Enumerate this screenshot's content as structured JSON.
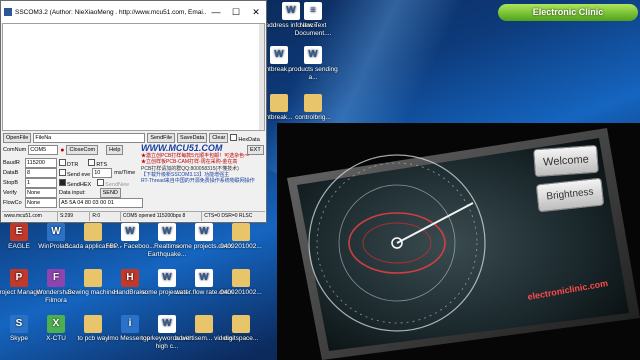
{
  "window": {
    "title": "SSCOM3.2 (Author: NieXiaoMeng . http://www.mcu51.com, Emai...",
    "controls": {
      "minimize": "—",
      "maximize": "☐",
      "close": "✕"
    }
  },
  "toolbar_row": {
    "open_file": "OpenFile",
    "file_name": "FileNa",
    "send_file": "SendFile",
    "save_data": "SaveData",
    "clear": "Clear",
    "hex_data": "HexData"
  },
  "port_row": {
    "comnum_label": "ComNum",
    "comnum_value": "COM5",
    "close_com": "CloseCom",
    "help": "Help",
    "ext": "EXT"
  },
  "settings": {
    "baud_label": "BaudR",
    "baud_value": "115200",
    "data_label": "DataB",
    "data_value": "8",
    "stop_label": "StopB",
    "stop_value": "1",
    "verify_label": "Verify",
    "verify_value": "None",
    "flow_label": "FlowCo",
    "flow_value": "None",
    "dtr": "DTR",
    "rts": "RTS",
    "send_eve": "Send eve",
    "interval": "10",
    "interval_unit": "ms/Time",
    "send_hex": "SendHEX",
    "send_new": "SendNew",
    "data_input_label": "Data input:",
    "send_button": "SEND",
    "data_input_value": "A5 5A 04 80 03 00 01"
  },
  "promo": {
    "line1": "★激立创PCB打样每款5元顺丰包邮！可选杂色～",
    "line2": "★立创样板PCB-CAM打样-周在采购-金在高",
    "line3": "PCB打样请加的群QQ:800058315(不懂技术)",
    "line4": "【下载升级新SSCOM3.13】功能增强主",
    "line5": "RT-Thread来自中国的开源免费操作系统物联网操作",
    "url": "WWW.MCU51.COM"
  },
  "statusbar": {
    "site": "www.mcu51.com",
    "s": "S:299",
    "r": "R:0",
    "port": "COM5 opened 115200bps 8",
    "lines": "CTS=0 DSR=0 RLSC"
  },
  "desktop_top": [
    {
      "label": "address info.docx",
      "icon": "word-doc-icon",
      "glyph": "W"
    },
    {
      "label": "New Text Document....",
      "icon": "text-file-icon",
      "glyph": "≡"
    },
    {
      "label": "ntbreak...",
      "icon": "word-doc-icon",
      "glyph": "W"
    },
    {
      "label": "products sending a...",
      "icon": "word-doc-icon",
      "glyph": "W"
    },
    {
      "label": "ntbreak...",
      "icon": "folder-icon",
      "glyph": ""
    },
    {
      "label": "controlbrig...",
      "icon": "file-icon",
      "glyph": ""
    }
  ],
  "desktop_left": [
    {
      "label": "EAGLE",
      "icon": "eagle-icon",
      "glyph": "E",
      "cls": "app"
    },
    {
      "label": "WinProlad...",
      "icon": "app-icon",
      "glyph": "W",
      "cls": "blue"
    },
    {
      "label": "Scada application...",
      "icon": "folder-icon",
      "glyph": "",
      "cls": "folder"
    },
    {
      "label": "FBP - Faceboo...",
      "icon": "word-doc-icon",
      "glyph": "W",
      "cls": "doc"
    },
    {
      "label": "Realtime Earthquake...",
      "icon": "word-doc-icon",
      "glyph": "W",
      "cls": "doc"
    },
    {
      "label": "some projects.docx",
      "icon": "word-doc-icon",
      "glyph": "W",
      "cls": "doc"
    },
    {
      "label": "0409201002...",
      "icon": "folder-icon",
      "glyph": "",
      "cls": "folder"
    },
    {
      "label": "Project Manager",
      "icon": "project-icon",
      "glyph": "P",
      "cls": "app"
    },
    {
      "label": "Wondershare Filmora",
      "icon": "filmora-icon",
      "glyph": "F",
      "cls": "purple"
    },
    {
      "label": "Sewing machines",
      "icon": "folder-icon",
      "glyph": "",
      "cls": "folder"
    },
    {
      "label": "HandBrake",
      "icon": "handbrake-icon",
      "glyph": "H",
      "cls": "app"
    },
    {
      "label": "some projects.d...",
      "icon": "word-doc-icon",
      "glyph": "W",
      "cls": "doc"
    },
    {
      "label": "water flow rate.docx",
      "icon": "word-doc-icon",
      "glyph": "W",
      "cls": "doc"
    },
    {
      "label": "0409201002...",
      "icon": "folder-icon",
      "glyph": "",
      "cls": "folder"
    },
    {
      "label": "Skype",
      "icon": "skype-icon",
      "glyph": "S",
      "cls": "blue"
    },
    {
      "label": "X-CTU",
      "icon": "xctu-icon",
      "glyph": "X",
      "cls": "green"
    },
    {
      "label": "to pcb way",
      "icon": "folder-icon",
      "glyph": "",
      "cls": "folder"
    },
    {
      "label": "Imo Messenger",
      "icon": "imo-icon",
      "glyph": "i",
      "cls": "blue"
    },
    {
      "label": "top keywords with high c...",
      "icon": "word-doc-icon",
      "glyph": "W",
      "cls": "doc"
    },
    {
      "label": "advertisem... videos",
      "icon": "folder-icon",
      "glyph": "",
      "cls": "folder"
    },
    {
      "label": "digitspace...",
      "icon": "file-icon",
      "glyph": "",
      "cls": "folder"
    }
  ],
  "video": {
    "welcome_button": "Welcome",
    "brightness_button": "Brightness",
    "watermark": "electroniclinic.com"
  },
  "brand_banner": "Electronic Clinic"
}
